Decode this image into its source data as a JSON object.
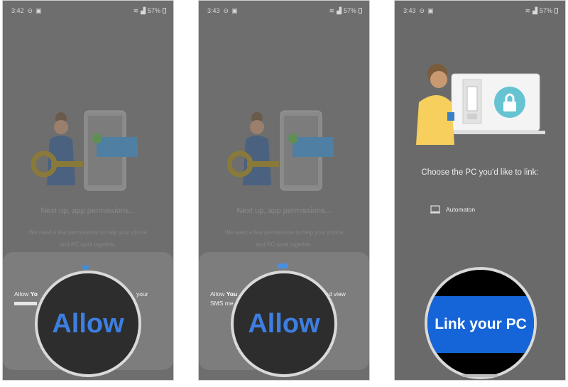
{
  "screens": [
    {
      "status": {
        "time": "3:42",
        "battery": "57%"
      },
      "heading": "Next up, app permissions...",
      "subtext_line1": "We need a few permissions to help your phone",
      "subtext_line2": "and PC work together.",
      "sheet": {
        "line1_start": "Allow ",
        "line1_bold": "Yo",
        "line1_end": "your"
      },
      "zoom_button_label": "Allow"
    },
    {
      "status": {
        "time": "3:43",
        "battery": "57%"
      },
      "heading": "Next up, app permissions...",
      "subtext_line1": "We need a few permissions to help your phone",
      "subtext_line2": "and PC work together.",
      "sheet": {
        "line1_start": "Allow ",
        "line1_bold": "You",
        "line1_end": "nd view",
        "line2": "SMS me"
      },
      "zoom_button_label": "Allow"
    },
    {
      "status": {
        "time": "3:43",
        "battery": "57%"
      },
      "choose_label": "Choose the PC you'd like to link:",
      "pc_name": "Automaton",
      "zoom_button_label": "Link your PC"
    }
  ],
  "colors": {
    "accent_blue": "#3d7fe0",
    "link_button": "#1565d8",
    "overlay_gray": "#6e6e6e"
  },
  "icons": [
    "dnd-icon",
    "image-icon",
    "wifi-icon",
    "signal-icon",
    "battery-icon",
    "computer-icon",
    "lock-icon",
    "check-icon",
    "key-icon"
  ]
}
